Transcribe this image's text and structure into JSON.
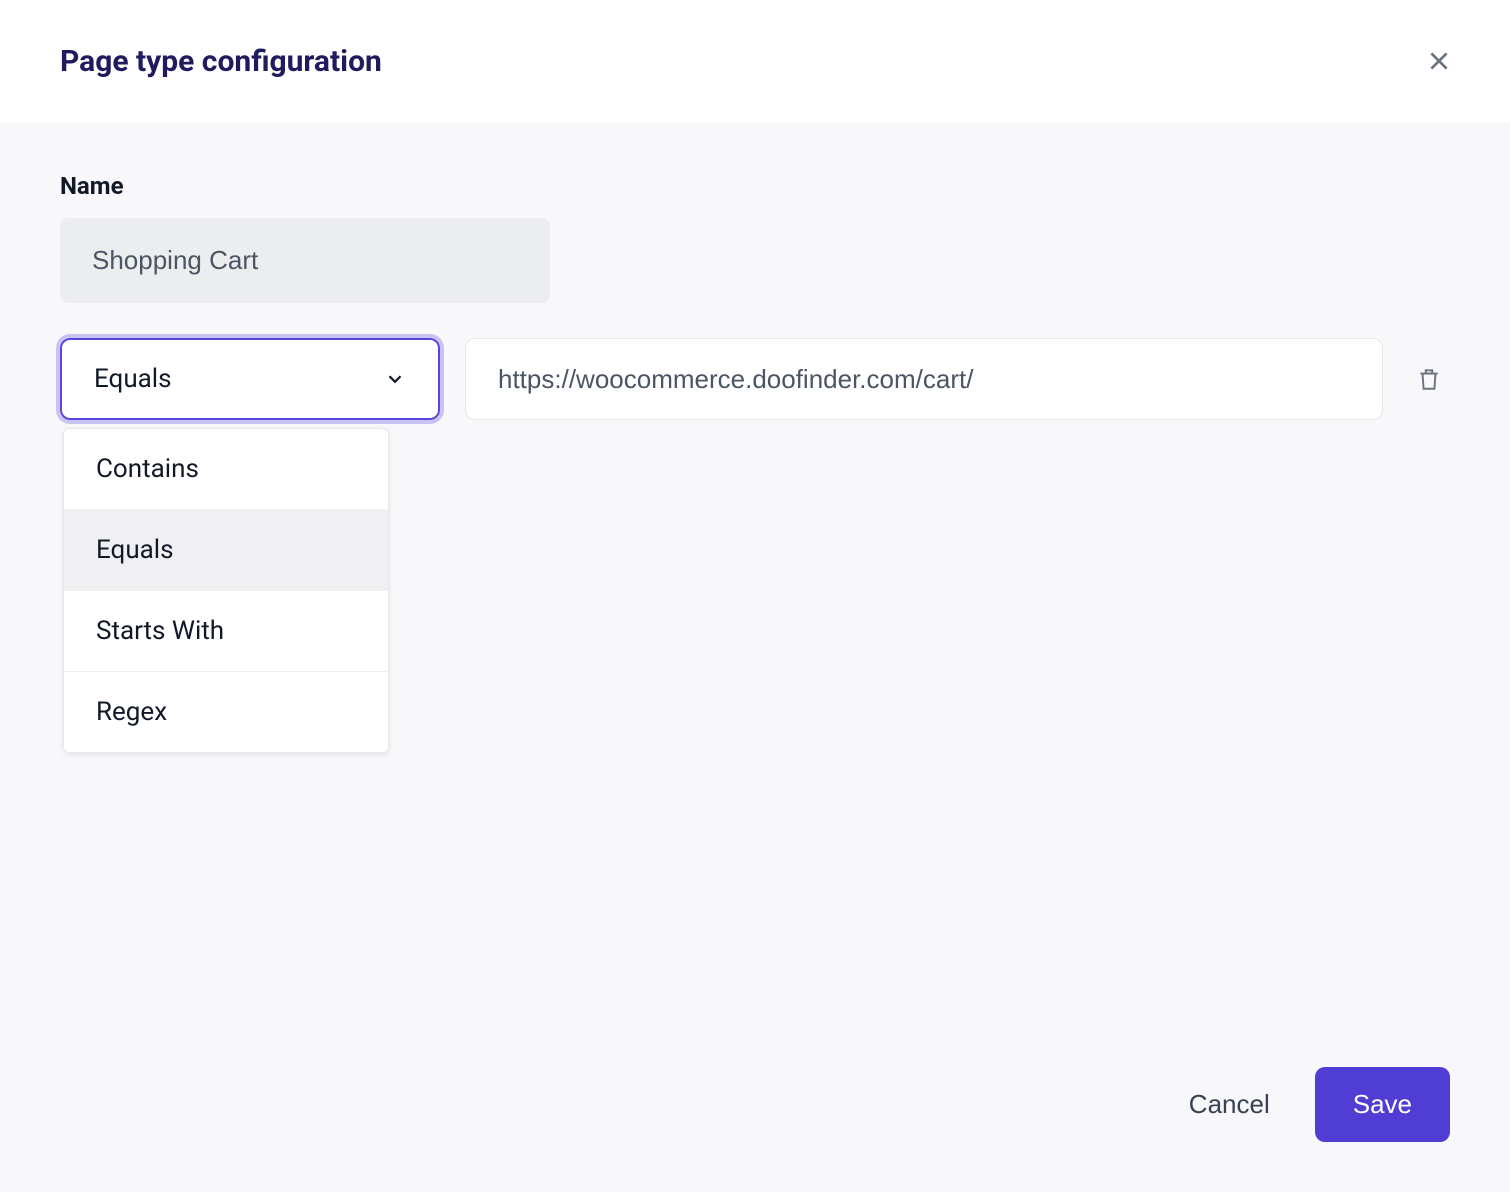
{
  "header": {
    "title": "Page type configuration"
  },
  "form": {
    "name_label": "Name",
    "name_value": "Shopping Cart",
    "rule": {
      "operator_selected": "Equals",
      "url_value": "https://woocommerce.doofinder.com/cart/"
    },
    "operator_options": [
      "Contains",
      "Equals",
      "Starts With",
      "Regex"
    ]
  },
  "footer": {
    "cancel_label": "Cancel",
    "save_label": "Save"
  }
}
